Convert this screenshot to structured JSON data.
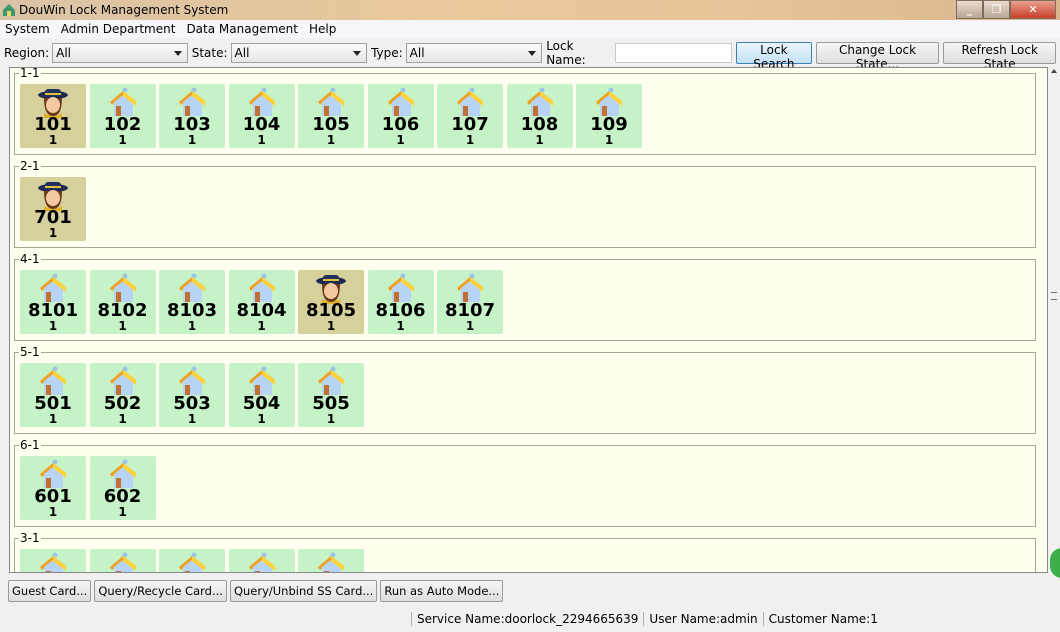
{
  "window": {
    "title": "DouWin Lock Management System"
  },
  "menu": [
    "System",
    "Admin Department",
    "Data Management",
    "Help"
  ],
  "filters": {
    "region_label": "Region:",
    "region_value": "All",
    "state_label": "State:",
    "state_value": "All",
    "type_label": "Type:",
    "type_value": "All",
    "lock_name_label": "Lock Name:",
    "lock_name_value": ""
  },
  "toolbar": {
    "lock_search": "Lock Search",
    "change_state": "Change Lock State...",
    "refresh": "Refresh Lock State"
  },
  "colors": {
    "vacant": "#c6f2c8",
    "occupied": "#d6d19c",
    "panel": "#fffff0"
  },
  "groups": [
    {
      "name": "1-1",
      "rooms": [
        {
          "number": "101",
          "count": "1",
          "state": "occupied"
        },
        {
          "number": "102",
          "count": "1",
          "state": "vacant"
        },
        {
          "number": "103",
          "count": "1",
          "state": "vacant"
        },
        {
          "number": "104",
          "count": "1",
          "state": "vacant"
        },
        {
          "number": "105",
          "count": "1",
          "state": "vacant"
        },
        {
          "number": "106",
          "count": "1",
          "state": "vacant"
        },
        {
          "number": "107",
          "count": "1",
          "state": "vacant"
        },
        {
          "number": "108",
          "count": "1",
          "state": "vacant"
        },
        {
          "number": "109",
          "count": "1",
          "state": "vacant"
        }
      ]
    },
    {
      "name": "2-1",
      "rooms": [
        {
          "number": "701",
          "count": "1",
          "state": "occupied"
        }
      ]
    },
    {
      "name": "4-1",
      "rooms": [
        {
          "number": "8101",
          "count": "1",
          "state": "vacant"
        },
        {
          "number": "8102",
          "count": "1",
          "state": "vacant"
        },
        {
          "number": "8103",
          "count": "1",
          "state": "vacant"
        },
        {
          "number": "8104",
          "count": "1",
          "state": "vacant"
        },
        {
          "number": "8105",
          "count": "1",
          "state": "occupied"
        },
        {
          "number": "8106",
          "count": "1",
          "state": "vacant"
        },
        {
          "number": "8107",
          "count": "1",
          "state": "vacant"
        }
      ]
    },
    {
      "name": "5-1",
      "rooms": [
        {
          "number": "501",
          "count": "1",
          "state": "vacant"
        },
        {
          "number": "502",
          "count": "1",
          "state": "vacant"
        },
        {
          "number": "503",
          "count": "1",
          "state": "vacant"
        },
        {
          "number": "504",
          "count": "1",
          "state": "vacant"
        },
        {
          "number": "505",
          "count": "1",
          "state": "vacant"
        }
      ]
    },
    {
      "name": "6-1",
      "rooms": [
        {
          "number": "601",
          "count": "1",
          "state": "vacant"
        },
        {
          "number": "602",
          "count": "1",
          "state": "vacant"
        }
      ]
    },
    {
      "name": "3-1",
      "rooms": [
        {
          "number": "",
          "count": "",
          "state": "vacant"
        },
        {
          "number": "",
          "count": "",
          "state": "vacant"
        },
        {
          "number": "",
          "count": "",
          "state": "vacant"
        },
        {
          "number": "",
          "count": "",
          "state": "vacant"
        },
        {
          "number": "",
          "count": "",
          "state": "vacant"
        }
      ]
    }
  ],
  "bottom": {
    "guest_card": "Guest Card...",
    "query_recycle": "Query/Recycle Card...",
    "query_unbind": "Query/Unbind SS Card...",
    "auto_mode": "Run as Auto Mode..."
  },
  "status": {
    "service": "Service Name:doorlock_2294665639",
    "user": "User Name:admin",
    "customer": "Customer Name:1"
  }
}
